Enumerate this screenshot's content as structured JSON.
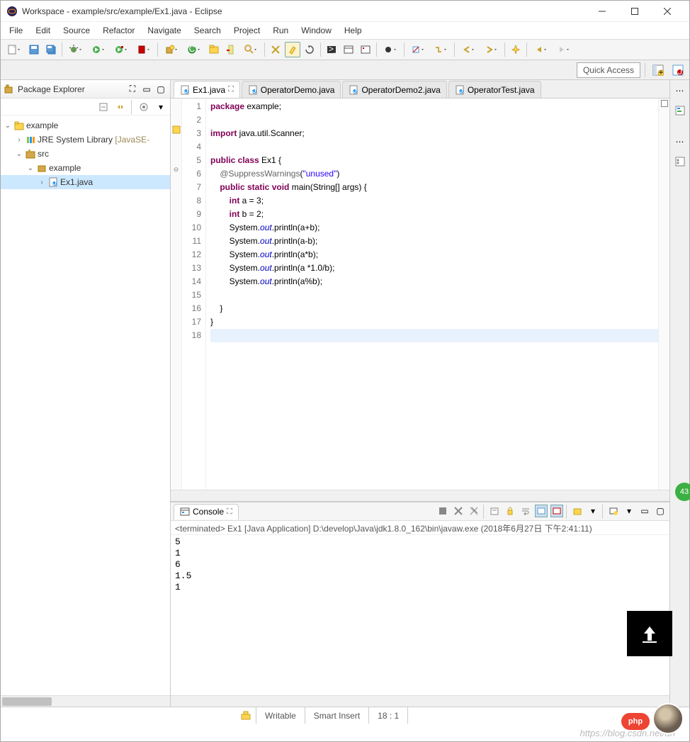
{
  "window": {
    "title": "Workspace - example/src/example/Ex1.java - Eclipse"
  },
  "menu": [
    "File",
    "Edit",
    "Source",
    "Refactor",
    "Navigate",
    "Search",
    "Project",
    "Run",
    "Window",
    "Help"
  ],
  "quick_access": "Quick Access",
  "package_explorer": {
    "title": "Package Explorer",
    "tree": {
      "project": "example",
      "jre": "JRE System Library",
      "jre_dec": "[JavaSE-",
      "src": "src",
      "pkg": "example",
      "file": "Ex1.java"
    }
  },
  "editor": {
    "tabs": [
      "Ex1.java",
      "OperatorDemo.java",
      "OperatorDemo2.java",
      "OperatorTest.java"
    ],
    "active_tab": 0,
    "line_count": 18,
    "code_tokens": [
      [
        [
          "kw",
          "package"
        ],
        [
          "",
          " example;"
        ]
      ],
      [
        [
          "",
          ""
        ]
      ],
      [
        [
          "kw",
          "import"
        ],
        [
          "",
          " java.util.Scanner;"
        ]
      ],
      [
        [
          "",
          ""
        ]
      ],
      [
        [
          "kw",
          "public class"
        ],
        [
          "",
          " Ex1 {"
        ]
      ],
      [
        [
          "",
          "    "
        ],
        [
          "ann",
          "@SuppressWarnings"
        ],
        [
          "",
          "("
        ],
        [
          "str",
          "\"unused\""
        ],
        [
          "",
          ")"
        ]
      ],
      [
        [
          "",
          "    "
        ],
        [
          "kw",
          "public static void"
        ],
        [
          "",
          " main(String[] args) {"
        ]
      ],
      [
        [
          "",
          "        "
        ],
        [
          "kw",
          "int"
        ],
        [
          "",
          " a = 3;"
        ]
      ],
      [
        [
          "",
          "        "
        ],
        [
          "kw",
          "int"
        ],
        [
          "",
          " b = 2;"
        ]
      ],
      [
        [
          "",
          "        System."
        ],
        [
          "fld",
          "out"
        ],
        [
          "",
          ".println(a+b);"
        ]
      ],
      [
        [
          "",
          "        System."
        ],
        [
          "fld",
          "out"
        ],
        [
          "",
          ".println(a-b);"
        ]
      ],
      [
        [
          "",
          "        System."
        ],
        [
          "fld",
          "out"
        ],
        [
          "",
          ".println(a*b);"
        ]
      ],
      [
        [
          "",
          "        System."
        ],
        [
          "fld",
          "out"
        ],
        [
          "",
          ".println(a *1.0/b);"
        ]
      ],
      [
        [
          "",
          "        System."
        ],
        [
          "fld",
          "out"
        ],
        [
          "",
          ".println(a%b);"
        ]
      ],
      [
        [
          "",
          ""
        ]
      ],
      [
        [
          "",
          "    }"
        ]
      ],
      [
        [
          "",
          "}"
        ]
      ],
      [
        [
          "",
          ""
        ]
      ]
    ]
  },
  "console": {
    "title": "Console",
    "info": "<terminated> Ex1 [Java Application] D:\\develop\\Java\\jdk1.8.0_162\\bin\\javaw.exe (2018年6月27日 下午2:41:11)",
    "output": "5\n1\n6\n1.5\n1"
  },
  "status": {
    "writable": "Writable",
    "insert": "Smart Insert",
    "pos": "18 : 1"
  },
  "watermark": "https://blog.csdn.net/an",
  "badge43": "43",
  "php": "php"
}
